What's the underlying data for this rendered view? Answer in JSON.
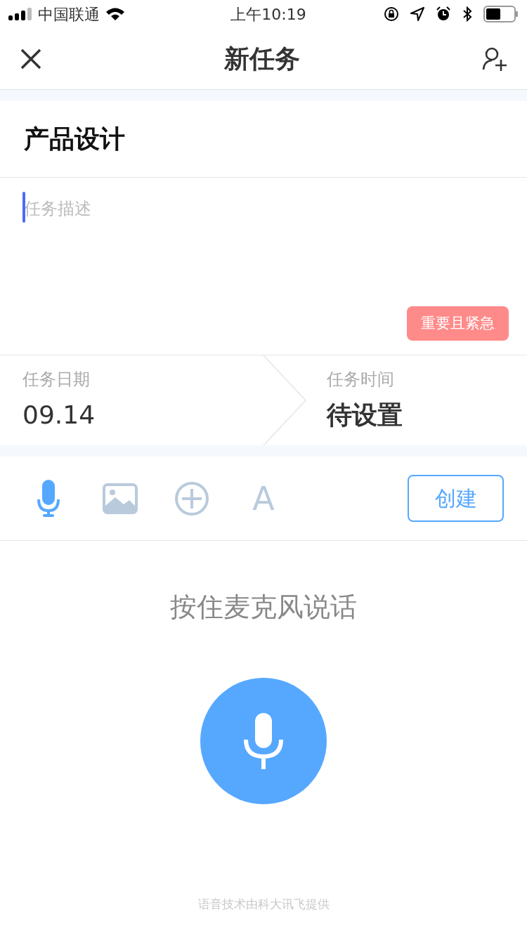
{
  "status_bar": {
    "carrier": "中国联通",
    "time": "上午10:19"
  },
  "nav": {
    "title": "新任务"
  },
  "task": {
    "title": "产品设计",
    "description": {
      "placeholder": "任务描述"
    },
    "priority": {
      "label": "重要且紧急",
      "color": "#ff8a8a"
    }
  },
  "schedule": [
    {
      "label": "任务日期",
      "value": "09.14"
    },
    {
      "label": "任务时间",
      "value": "待设置"
    }
  ],
  "tools": [
    {
      "kind": "mic",
      "selected": true
    },
    {
      "kind": "image",
      "selected": false
    },
    {
      "kind": "add",
      "selected": false
    },
    {
      "kind": "text",
      "label": "A",
      "selected": false
    }
  ],
  "create_button": "创建",
  "voice": {
    "hint": "按住麦克风说话",
    "credit": "语音技术由科大讯飞提供"
  }
}
